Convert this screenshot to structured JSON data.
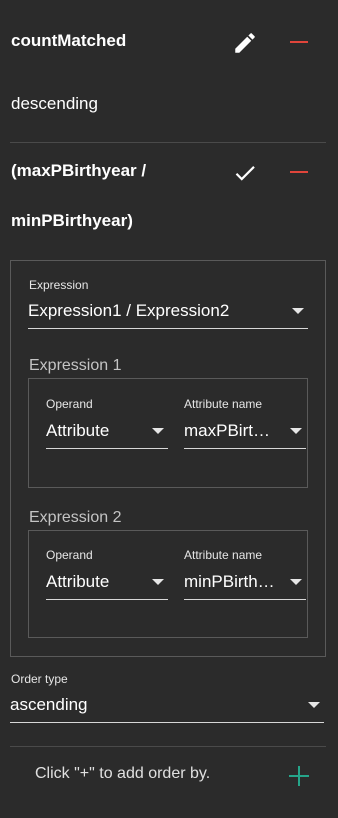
{
  "orders": [
    {
      "name": "countMatched",
      "direction": "descending"
    },
    {
      "name_line1": "(maxPBirthyear /",
      "name_line2": "minPBirthyear)"
    }
  ],
  "editor": {
    "expression_label": "Expression",
    "expression_value": "Expression1 / Expression2",
    "expr1": {
      "title": "Expression 1",
      "operand_label": "Operand",
      "operand_value": "Attribute",
      "attr_label": "Attribute name",
      "attr_value": "maxPBirt…"
    },
    "expr2": {
      "title": "Expression 2",
      "operand_label": "Operand",
      "operand_value": "Attribute",
      "attr_label": "Attribute name",
      "attr_value": "minPBirth…"
    }
  },
  "order_type": {
    "label": "Order type",
    "value": "ascending"
  },
  "footer": {
    "hint": "Click \"+\" to add order by."
  },
  "colors": {
    "accent_remove": "#e0453b",
    "accent_add": "#25a58a",
    "background": "#2b2b2b"
  },
  "icons": [
    "pencil-icon",
    "minus-icon",
    "check-icon",
    "caret-down-icon",
    "plus-icon"
  ]
}
